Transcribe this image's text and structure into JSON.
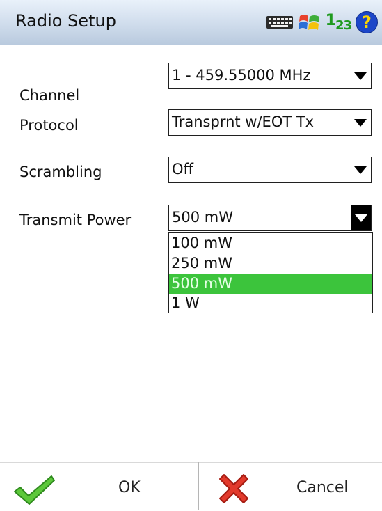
{
  "window": {
    "title": "Radio Setup"
  },
  "tray": {
    "input_mode_main": "1",
    "input_mode_sub1": "2",
    "input_mode_sub2": "3",
    "help_glyph": "?"
  },
  "fields": {
    "channel": {
      "label": "Channel",
      "value": "1 - 459.55000 MHz"
    },
    "protocol": {
      "label": "Protocol",
      "value": "Transprnt w/EOT Tx"
    },
    "scrambling": {
      "label": "Scrambling",
      "value": "Off"
    },
    "transmit_power": {
      "label": "Transmit Power",
      "value": "500 mW",
      "options": [
        "100 mW",
        "250 mW",
        "500 mW",
        "1 W"
      ],
      "highlighted_option": "500 mW"
    }
  },
  "buttons": {
    "ok_label": "OK",
    "cancel_label": "Cancel"
  },
  "icons": {
    "keyboard": "keyboard-icon",
    "windows": "windows-flag-icon",
    "input_mode": "input-mode-icon",
    "help": "help-icon",
    "ok": "checkmark-icon",
    "cancel": "x-icon"
  },
  "colors": {
    "highlight": "#3cc43c",
    "check": "#5cc83a",
    "cancel": "#e23a2c"
  }
}
